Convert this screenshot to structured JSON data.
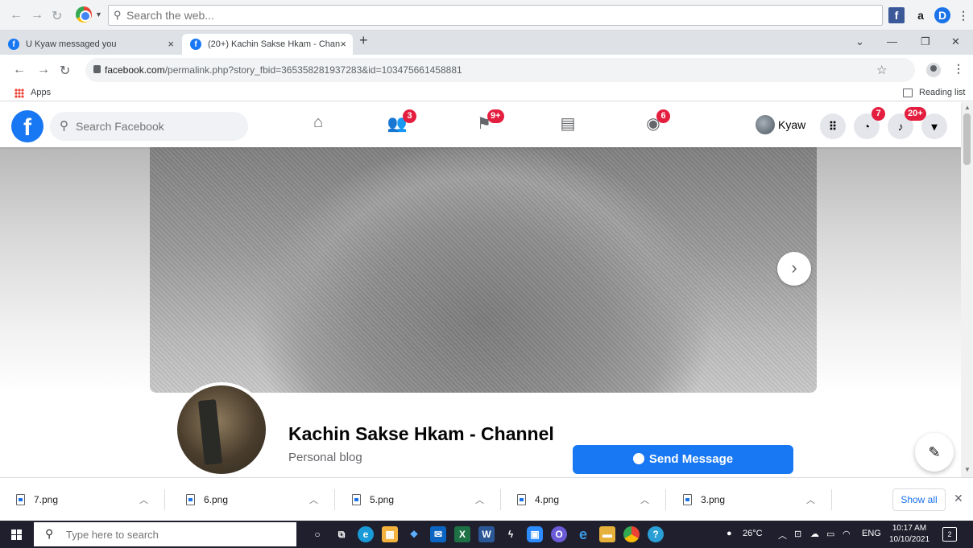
{
  "browser": {
    "search_placeholder": "Search the web...",
    "tabs": [
      {
        "title": "U Kyaw messaged you",
        "close": "×"
      },
      {
        "title": "(20+) Kachin Sakse Hkam - Chan",
        "close": "×"
      }
    ],
    "new_tab": "+",
    "url_domain": "facebook.com",
    "url_path": "/permalink.php?story_fbid=365358281937283&id=103475661458881",
    "bookmarks": {
      "apps": "Apps",
      "reading_list": "Reading list"
    },
    "extensions": [
      "f",
      "a",
      "D"
    ]
  },
  "facebook": {
    "search_placeholder": "Search Facebook",
    "badges": {
      "friends": "3",
      "pages": "9+",
      "groups": "6",
      "messenger": "7",
      "notifications": "20+"
    },
    "user_name": "Kyaw"
  },
  "page": {
    "name": "Kachin Sakse Hkam - Channel",
    "category": "Personal blog",
    "send_message": "Send Message"
  },
  "downloads": {
    "items": [
      "7.png",
      "6.png",
      "5.png",
      "4.png",
      "3.png"
    ],
    "show_all": "Show all"
  },
  "taskbar": {
    "search_placeholder": "Type here to search",
    "weather": "26°C",
    "language": "ENG",
    "time": "10:17 AM",
    "date": "10/10/2021",
    "notifications": "2"
  },
  "colors": {
    "facebook_blue": "#1877f2",
    "badge_red": "#e41e3f",
    "download_link": "#1a73e8"
  }
}
